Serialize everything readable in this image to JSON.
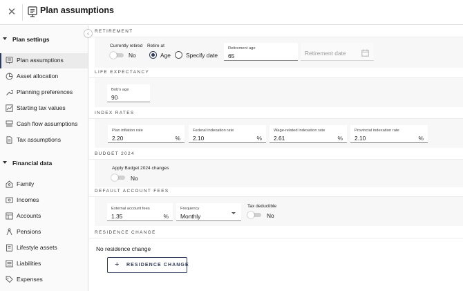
{
  "header": {
    "title": "Plan assumptions",
    "close_icon": "close-icon",
    "title_icon": "plan-doc-icon"
  },
  "sidebar": {
    "sections": [
      {
        "label": "Plan settings",
        "expanded": true
      },
      {
        "label": "Financial data",
        "expanded": true
      }
    ],
    "plan_settings_items": [
      {
        "label": "Plan assumptions",
        "icon": "plan-doc-icon",
        "active": true
      },
      {
        "label": "Asset allocation",
        "icon": "pie-chart-icon"
      },
      {
        "label": "Planning preferences",
        "icon": "wrench-icon"
      },
      {
        "label": "Starting tax values",
        "icon": "line-chart-icon"
      },
      {
        "label": "Cash flow assumptions",
        "icon": "cash-stack-icon"
      },
      {
        "label": "Tax assumptions",
        "icon": "document-icon"
      }
    ],
    "financial_items": [
      {
        "label": "Family",
        "icon": "family-icon"
      },
      {
        "label": "Incomes",
        "icon": "income-icon"
      },
      {
        "label": "Accounts",
        "icon": "accounts-icon"
      },
      {
        "label": "Pensions",
        "icon": "pension-icon"
      },
      {
        "label": "Lifestyle assets",
        "icon": "building-icon"
      },
      {
        "label": "Liabilities",
        "icon": "liabilities-icon"
      },
      {
        "label": "Expenses",
        "icon": "tag-icon"
      }
    ]
  },
  "retirement": {
    "section_label": "RETIREMENT",
    "currently_retired_label": "Currently retired",
    "currently_retired_value": "No",
    "retire_at_label": "Retire at",
    "option_age": "Age",
    "option_specify_date": "Specify date",
    "selected": "Age",
    "retirement_age_label": "Retirement age",
    "retirement_age_value": "65",
    "retirement_date_placeholder": "Retirement date"
  },
  "life_expectancy": {
    "section_label": "LIFE EXPECTANCY",
    "age_label": "Bob's age",
    "age_value": "90"
  },
  "index_rates": {
    "section_label": "INDEX RATES",
    "fields": [
      {
        "label": "Plan inflation rate",
        "value": "2.20",
        "suffix": "%"
      },
      {
        "label": "Federal indexation rate",
        "value": "2.10",
        "suffix": "%"
      },
      {
        "label": "Wage-related indexation rate",
        "value": "2.61",
        "suffix": "%"
      },
      {
        "label": "Provincial indexation rate",
        "value": "2.10",
        "suffix": "%"
      }
    ]
  },
  "budget": {
    "section_label": "BUDGET 2024",
    "apply_label": "Apply Budget 2024 changes",
    "apply_value": "No"
  },
  "account_fees": {
    "section_label": "DEFAULT ACCOUNT FEES",
    "external_label": "External account fees",
    "external_value": "1.35",
    "external_suffix": "%",
    "frequency_label": "Frequency",
    "frequency_value": "Monthly",
    "tax_deductible_label": "Tax deductible",
    "tax_deductible_value": "No"
  },
  "residence": {
    "section_label": "RESIDENCE CHANGE",
    "status_text": "No residence change",
    "button_label": "RESIDENCE CHANGE"
  },
  "colors": {
    "accent": "#2e3a59",
    "band": "#f7f7f7",
    "sidebar_bg": "#fafafa"
  }
}
